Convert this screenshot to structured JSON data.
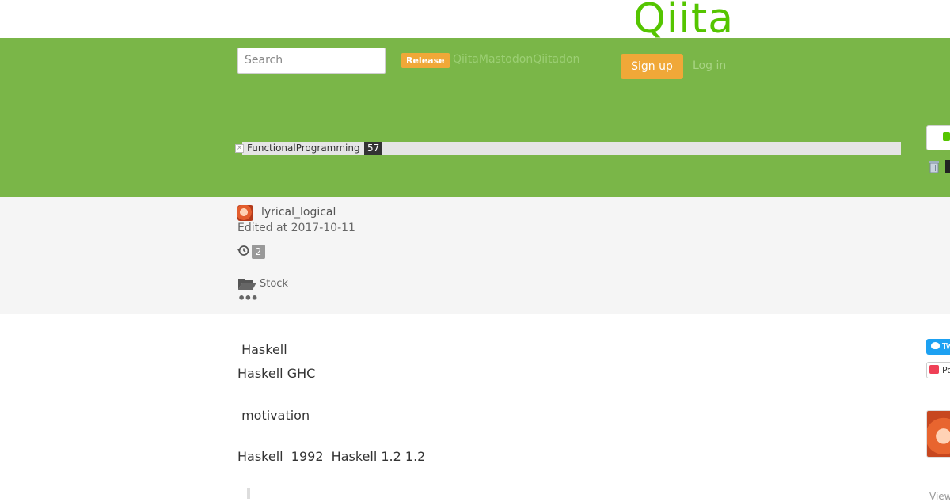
{
  "header": {
    "logo_text": "Qiita",
    "search_placeholder": "Search",
    "release_badge": "Release",
    "release_link": "QiitaMastodonQiitadon",
    "signup_label": "Sign up",
    "login_label": "Log in"
  },
  "tag": {
    "name": "FunctionalProgramming",
    "count": "57"
  },
  "meta": {
    "author": "lyrical_logical",
    "edited": "Edited at 2017-10-11",
    "history_count": "2",
    "stock_label": "Stock",
    "more_label": "•••"
  },
  "article": {
    "heading1": " Haskell",
    "line1": "Haskell GHC",
    "heading2": " motivation",
    "line2": "Haskell  1992  Haskell 1.2 1.2"
  },
  "sidebar": {
    "tweet_label": "Tweet",
    "pocket_label": "Pocket",
    "view_label": "View"
  },
  "colors": {
    "brand_green": "#55c500",
    "header_green": "#7ab648",
    "accent_orange": "#f0a838"
  }
}
